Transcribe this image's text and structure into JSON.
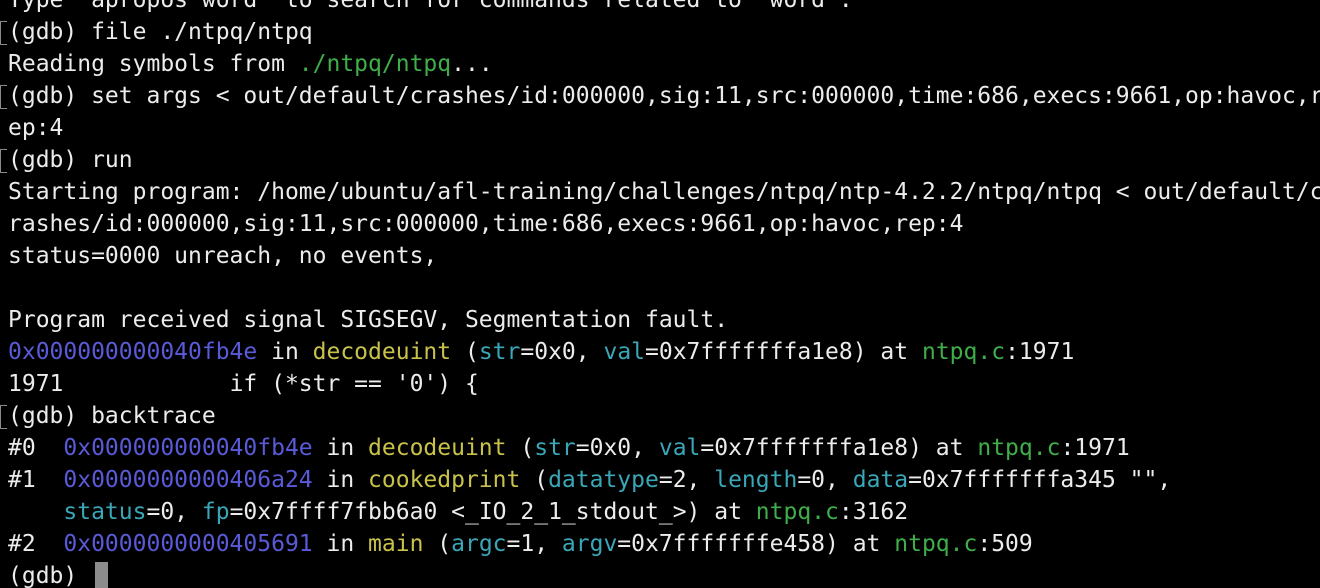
{
  "terminal": {
    "line0": "Type \"apropos word\" to search for commands related to \"word\".",
    "line1": "(gdb) file ./ntpq/ntpq",
    "line2": {
      "pre": "Reading symbols from ",
      "path": "./ntpq/ntpq",
      "post": "..."
    },
    "line3": "(gdb) set args < out/default/crashes/id:000000,sig:11,src:000000,time:686,execs:9661,op:havoc,r",
    "line4": "ep:4",
    "line5": "(gdb) run",
    "line6": "Starting program: /home/ubuntu/afl-training/challenges/ntpq/ntp-4.2.2/ntpq/ntpq < out/default/c",
    "line7": "rashes/id:000000,sig:11,src:000000,time:686,execs:9661,op:havoc,rep:4",
    "line8": "status=0000 unreach, no events,",
    "line10": "Program received signal SIGSEGV, Segmentation fault.",
    "line11": {
      "addr": "0x000000000040fb4e",
      "in": " in ",
      "fn": "decodeuint",
      "open": " (",
      "a1": "str",
      "v1": "=0x0, ",
      "a2": "val",
      "v2": "=0x7fffffffa1e8) at ",
      "file": "ntpq.c",
      "lineno": ":1971"
    },
    "line12": "1971\t\tif (*str == '0') {",
    "line13": "(gdb) backtrace",
    "bt0": {
      "num": "#0  ",
      "addr": "0x000000000040fb4e",
      "in": " in ",
      "fn": "decodeuint",
      "open": " (",
      "a1": "str",
      "v1": "=0x0, ",
      "a2": "val",
      "v2": "=0x7fffffffa1e8) at ",
      "file": "ntpq.c",
      "lineno": ":1971"
    },
    "bt1": {
      "num": "#1  ",
      "addr": "0x0000000000406a24",
      "in": " in ",
      "fn": "cookedprint",
      "open": " (",
      "a1": "datatype",
      "v1": "=2, ",
      "a2": "length",
      "v2": "=0, ",
      "a3": "data",
      "v3": "=0x7fffffffa345 \"\","
    },
    "bt1b": {
      "indent": "    ",
      "a4": "status",
      "v4": "=0, ",
      "a5": "fp",
      "v5": "=0x7ffff7fbb6a0 <_IO_2_1_stdout_>) at ",
      "file": "ntpq.c",
      "lineno": ":3162"
    },
    "bt2": {
      "num": "#2  ",
      "addr": "0x0000000000405691",
      "in": " in ",
      "fn": "main",
      "open": " (",
      "a1": "argc",
      "v1": "=1, ",
      "a2": "argv",
      "v2": "=0x7fffffffe458) at ",
      "file": "ntpq.c",
      "lineno": ":509"
    },
    "prompt": "(gdb) ",
    "colors": {
      "address": "#5a5ad8",
      "function": "#c9c24a",
      "argument": "#3aa7b8",
      "file": "#3fae4a",
      "text": "#ececec",
      "background": "#000000"
    }
  }
}
